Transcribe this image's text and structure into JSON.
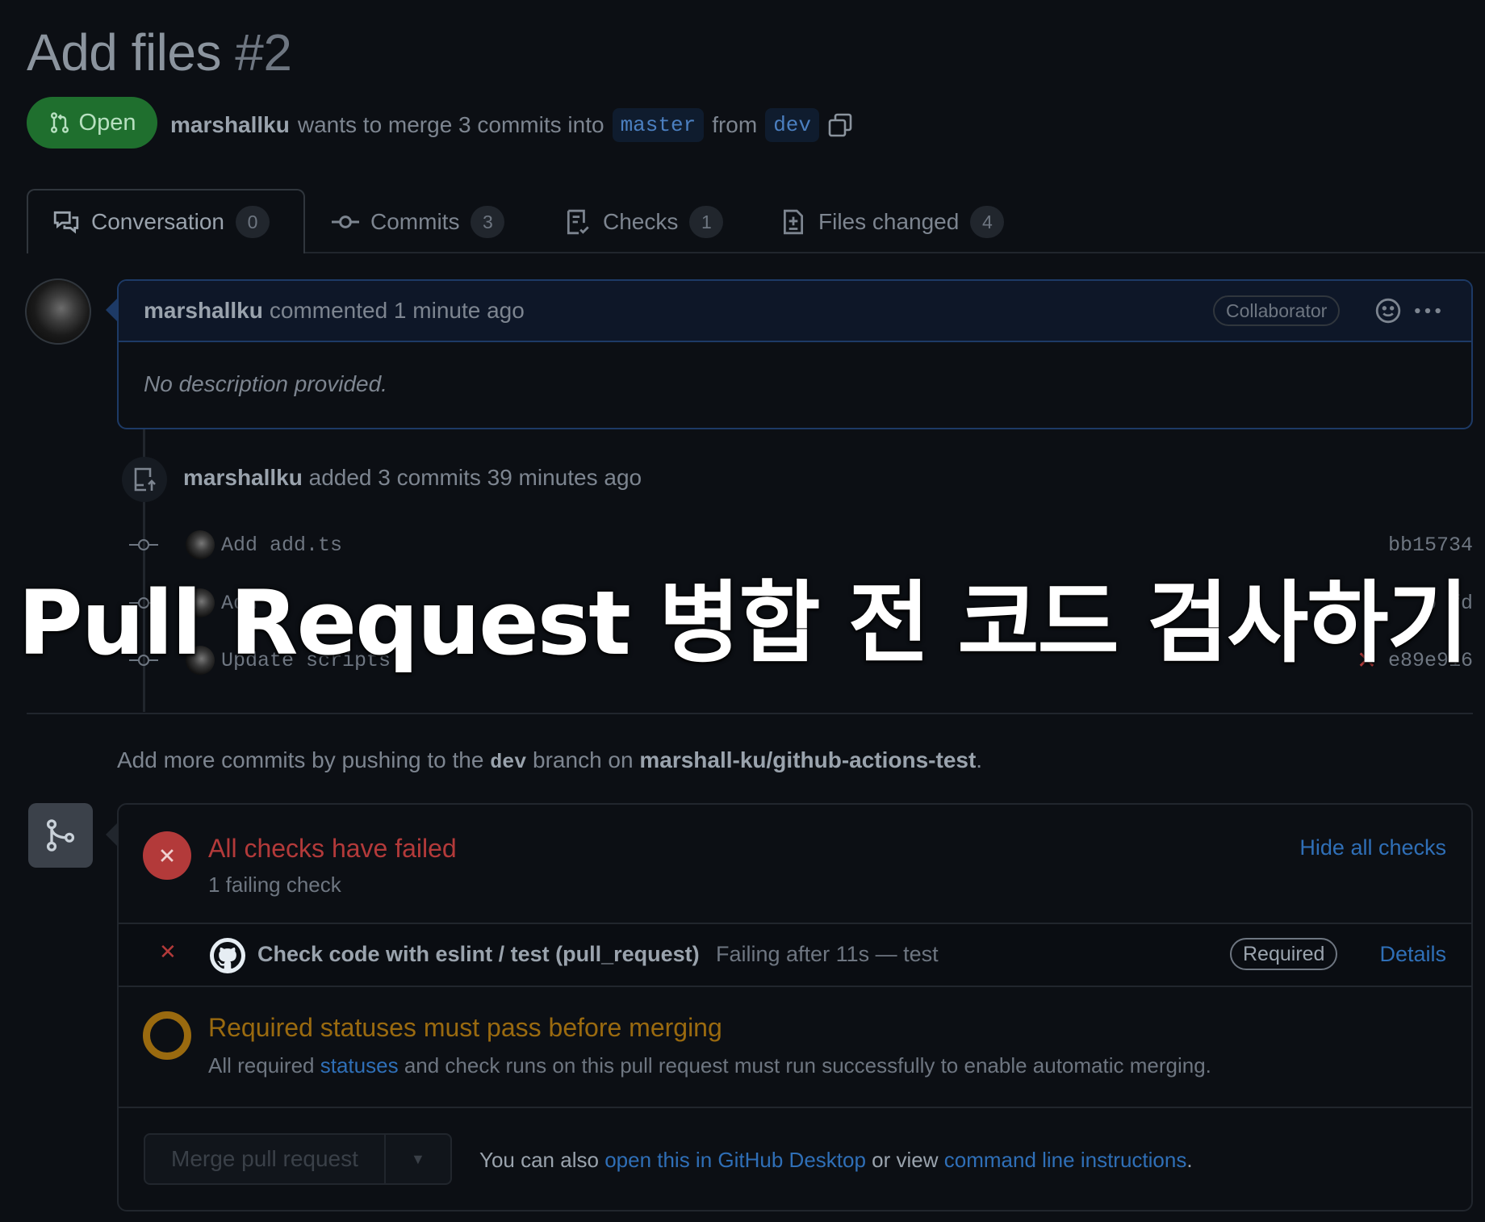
{
  "pr": {
    "title": "Add files",
    "number": "#2",
    "state": "Open",
    "author": "marshallku",
    "merge_text": "wants to merge 3 commits into",
    "base_branch": "master",
    "from_text": "from",
    "head_branch": "dev"
  },
  "tabs": [
    {
      "label": "Conversation",
      "count": "0",
      "icon": "comment-discussion-icon"
    },
    {
      "label": "Commits",
      "count": "3",
      "icon": "git-commit-icon"
    },
    {
      "label": "Checks",
      "count": "1",
      "icon": "checklist-icon"
    },
    {
      "label": "Files changed",
      "count": "4",
      "icon": "file-diff-icon"
    }
  ],
  "comment": {
    "author": "marshallku",
    "action": "commented 1 minute ago",
    "role": "Collaborator",
    "body": "No description provided."
  },
  "push_event": {
    "author": "marshallku",
    "text": "added 3 commits 39 minutes ago"
  },
  "commits": [
    {
      "message": "Add add.ts",
      "sha": "bb15734",
      "failed": false
    },
    {
      "message": "Add",
      "sha": "b     fd",
      "failed": false
    },
    {
      "message": "Update scripts",
      "sha": "e89e916",
      "failed": true
    }
  ],
  "push_hint": {
    "prefix": "Add more commits by pushing to the",
    "branch": "dev",
    "middle": "branch on",
    "repo": "marshall-ku/github-actions-test",
    "suffix": "."
  },
  "checks": {
    "title": "All checks have failed",
    "subtitle": "1 failing check",
    "toggle": "Hide all checks",
    "item_name": "Check code with eslint / test (pull_request)",
    "item_status": "Failing after 11s — test",
    "required": "Required",
    "details": "Details"
  },
  "requirements": {
    "title": "Required statuses must pass before merging",
    "text_prefix": "All required",
    "statuses_link": "statuses",
    "text_suffix": "and check runs on this pull request must run successfully to enable automatic merging."
  },
  "merge": {
    "button": "Merge pull request",
    "also_text": "You can also",
    "desktop_link": "open this in GitHub Desktop",
    "or_text": "or view",
    "cli_link": "command line instructions",
    "end": "."
  },
  "overlay": {
    "title": "Pull Request 병합 전 코드 검사하기"
  },
  "colors": {
    "open_green": "#1f6f2e",
    "fail_red": "#b33a3a",
    "pending_amber": "#9a6a0f",
    "link_blue": "#2f6fb7"
  }
}
